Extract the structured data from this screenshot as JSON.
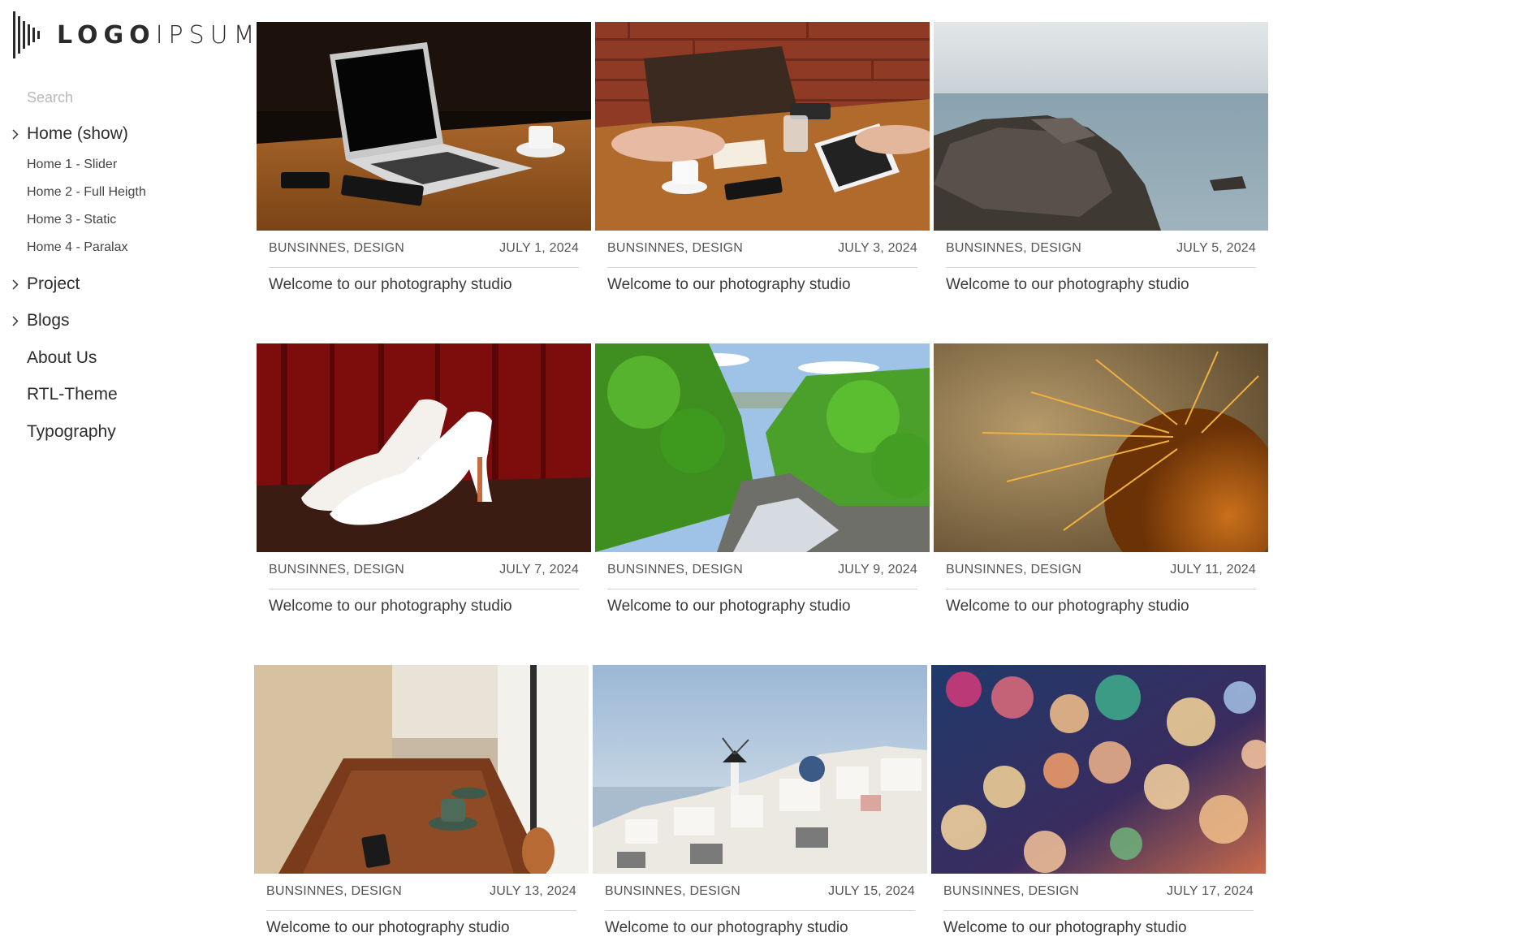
{
  "logo": {
    "text_bold": "LOGO",
    "text_light": "IPSUM"
  },
  "search": {
    "placeholder": "Search",
    "icon": "search-field"
  },
  "nav": {
    "items": [
      {
        "label": "Home (show)",
        "has_children": true,
        "expanded": true
      },
      {
        "label": "Home 1 - Slider",
        "sub": true
      },
      {
        "label": "Home 2 - Full Heigth",
        "sub": true
      },
      {
        "label": "Home 3 - Static",
        "sub": true
      },
      {
        "label": "Home 4 - Paralax",
        "sub": true
      },
      {
        "label": "Project",
        "has_children": true
      },
      {
        "label": "Blogs",
        "has_children": true
      },
      {
        "label": "About Us"
      },
      {
        "label": "RTL-Theme"
      },
      {
        "label": "Typography"
      }
    ],
    "chevron_icon": "chevron-right-icon"
  },
  "posts": [
    {
      "category": "BUNSINNES, DESIGN",
      "date": "JULY 1, 2024",
      "title": "Welcome to our photography studio",
      "photo": "laptop on wooden table"
    },
    {
      "category": "BUNSINNES, DESIGN",
      "date": "JULY 3, 2024",
      "title": "Welcome to our photography studio",
      "photo": "meeting table with tablet and coffee"
    },
    {
      "category": "BUNSINNES, DESIGN",
      "date": "JULY 5, 2024",
      "title": "Welcome to our photography studio",
      "photo": "rocky sea shore"
    },
    {
      "category": "BUNSINNES, DESIGN",
      "date": "JULY 7, 2024",
      "title": "Welcome to our photography studio",
      "photo": "white heels on red stage"
    },
    {
      "category": "BUNSINNES, DESIGN",
      "date": "JULY 9, 2024",
      "title": "Welcome to our photography studio",
      "photo": "green forest river"
    },
    {
      "category": "BUNSINNES, DESIGN",
      "date": "JULY 11, 2024",
      "title": "Welcome to our photography studio",
      "photo": "cactus spines close-up"
    },
    {
      "category": "BUNSINNES, DESIGN",
      "date": "JULY 13, 2024",
      "title": "Welcome to our photography studio",
      "photo": "cafe table with coffee cups"
    },
    {
      "category": "BUNSINNES, DESIGN",
      "date": "JULY 15, 2024",
      "title": "Welcome to our photography studio",
      "photo": "white village by the sea"
    },
    {
      "category": "BUNSINNES, DESIGN",
      "date": "JULY 17, 2024",
      "title": "Welcome to our photography studio",
      "photo": "colorful bokeh lights"
    }
  ],
  "colors": {
    "text": "#333333",
    "muted": "#b8b8b8",
    "rule": "#d4d4d4",
    "background": "#ffffff"
  }
}
